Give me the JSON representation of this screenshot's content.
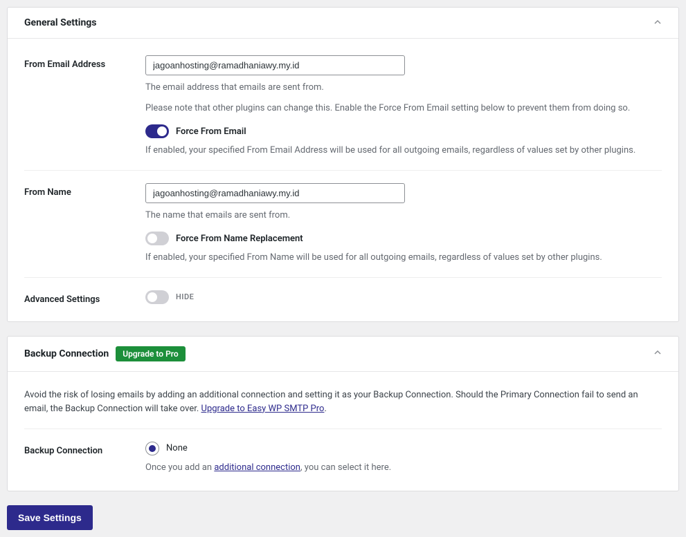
{
  "general": {
    "title": "General Settings",
    "from_email": {
      "label": "From Email Address",
      "value": "jagoanhosting@ramadhaniawy.my.id",
      "help1": "The email address that emails are sent from.",
      "help2": "Please note that other plugins can change this. Enable the Force From Email setting below to prevent them from doing so.",
      "force_label": "Force From Email",
      "force_help": "If enabled, your specified From Email Address will be used for all outgoing emails, regardless of values set by other plugins."
    },
    "from_name": {
      "label": "From Name",
      "value": "jagoanhosting@ramadhaniawy.my.id",
      "help": "The name that emails are sent from.",
      "force_label": "Force From Name Replacement",
      "force_help": "If enabled, your specified From Name will be used for all outgoing emails, regardless of values set by other plugins."
    },
    "advanced": {
      "label": "Advanced Settings",
      "toggle_text": "HIDE"
    }
  },
  "backup": {
    "title": "Backup Connection",
    "badge": "Upgrade to Pro",
    "desc_prefix": "Avoid the risk of losing emails by adding an additional connection and setting it as your Backup Connection. Should the Primary Connection fail to send an email, the Backup Connection will take over. ",
    "desc_link": "Upgrade to Easy WP SMTP Pro",
    "desc_suffix": ".",
    "row_label": "Backup Connection",
    "radio_label": "None",
    "help_prefix": "Once you add an ",
    "help_link": "additional connection",
    "help_suffix": ", you can select it here."
  },
  "save_button": "Save Settings"
}
